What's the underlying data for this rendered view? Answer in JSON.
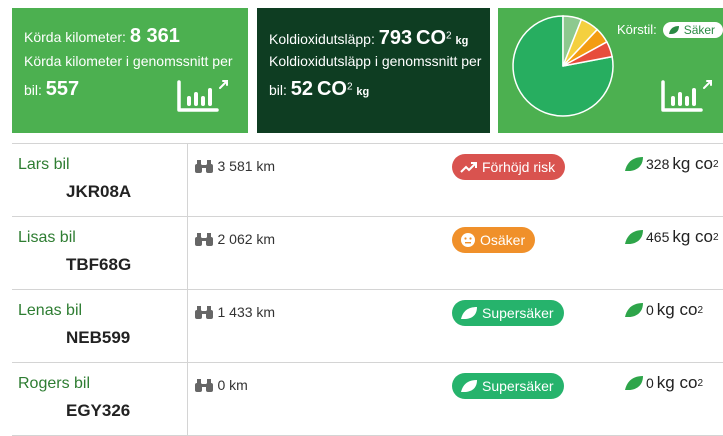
{
  "cards": {
    "km": {
      "label": "Körda kilometer:",
      "value": "8 361",
      "avg_label_1": "Körda kilometer i genomssnitt per",
      "avg_label_2": "bil:",
      "avg_value": "557"
    },
    "co2": {
      "label": "Koldioxidutsläpp:",
      "value": "793",
      "unit": "CO",
      "sup": "2",
      "sub_unit": "kg",
      "avg_label_1": "Koldioxidutsläpp i genomssnitt per",
      "avg_label_2": "bil:",
      "avg_value": "52",
      "avg_unit": "CO",
      "avg_sup": "2",
      "avg_sub_unit": "kg"
    },
    "style": {
      "label": "Körstil:",
      "badge": "Säker"
    }
  },
  "pie": {
    "slices": [
      {
        "name": "green",
        "fraction": 0.78,
        "color": "#27ae60"
      },
      {
        "name": "light-green",
        "fraction": 0.06,
        "color": "#8dc98f"
      },
      {
        "name": "yellow",
        "fraction": 0.06,
        "color": "#f4d03f"
      },
      {
        "name": "orange",
        "fraction": 0.05,
        "color": "#f39c12"
      },
      {
        "name": "red",
        "fraction": 0.05,
        "color": "#e74c3c"
      }
    ]
  },
  "cars": [
    {
      "name": "Lars bil",
      "plate": "JKR08A",
      "km": "3 581 km",
      "risk": "Förhöjd risk",
      "risk_type": "red",
      "co2_value": "328",
      "co2_unit": "kg co",
      "co2_sup": "2"
    },
    {
      "name": "Lisas bil",
      "plate": "TBF68G",
      "km": "2 062 km",
      "risk": "Osäker",
      "risk_type": "orange",
      "co2_value": "465",
      "co2_unit": "kg co",
      "co2_sup": "2"
    },
    {
      "name": "Lenas bil",
      "plate": "NEB599",
      "km": "1 433 km",
      "risk": "Supersäker",
      "risk_type": "green",
      "co2_value": "0",
      "co2_unit": "kg co",
      "co2_sup": "2"
    },
    {
      "name": "Rogers bil",
      "plate": "EGY326",
      "km": "0 km",
      "risk": "Supersäker",
      "risk_type": "green",
      "co2_value": "0",
      "co2_unit": "kg co",
      "co2_sup": "2"
    }
  ],
  "colors": {
    "brand_green": "#4cb050",
    "dark_green": "#0e3d22",
    "risk_red": "#d9534f",
    "risk_orange": "#f0902a",
    "risk_green": "#26b36c"
  },
  "icons": [
    "stats-expand-icon",
    "binoculars-icon",
    "trend-up-icon",
    "neutral-face-icon",
    "leaf-icon"
  ]
}
